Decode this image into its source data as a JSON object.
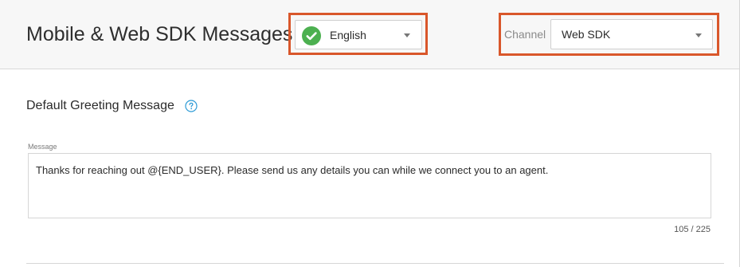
{
  "header": {
    "title": "Mobile & Web SDK Messages",
    "language_select": {
      "value": "English",
      "status_icon": "check-circle-icon",
      "status_color": "#4cb050"
    },
    "channel": {
      "label": "Channel",
      "value": "Web SDK"
    },
    "highlight_color": "#d9572b"
  },
  "section": {
    "title": "Default Greeting Message",
    "help_icon": "question-circle-icon",
    "help_icon_color": "#2e9bd6"
  },
  "message_field": {
    "label": "Message",
    "value": "Thanks for reaching out @{END_USER}. Please send us any details you can while we connect you to an agent.",
    "counter": "105 / 225"
  }
}
